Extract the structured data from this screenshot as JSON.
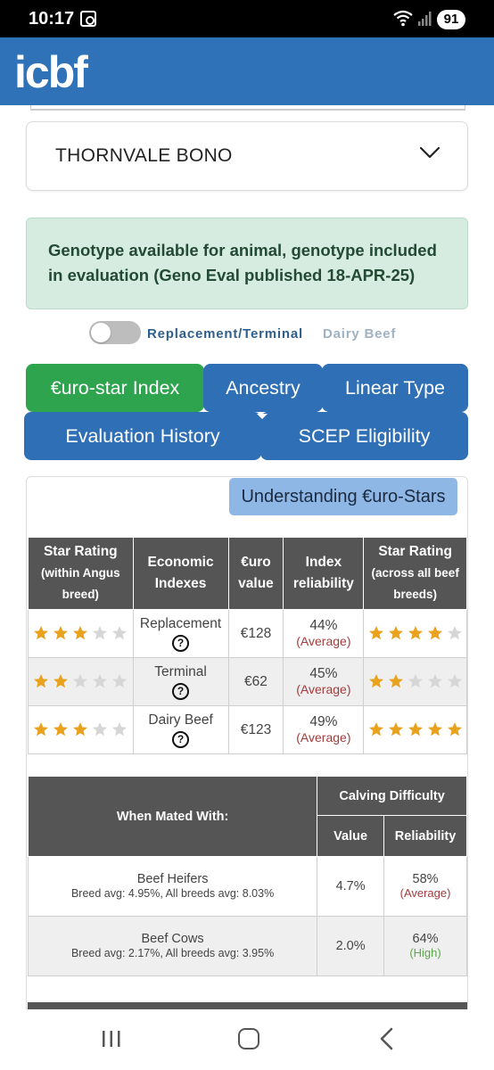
{
  "status_bar": {
    "time": "10:17",
    "battery": "91"
  },
  "header": {
    "logo_text": "icbf"
  },
  "animal": {
    "name": "THORNVALE BONO"
  },
  "alert": {
    "text": "Genotype available for animal, genotype included in evaluation (Geno Eval published 18-APR-25)"
  },
  "toggle": {
    "label_active": "Replacement/Terminal",
    "label_inactive": "Dairy Beef",
    "state": "off"
  },
  "tabs": [
    {
      "label": "€uro-star Index",
      "active": true
    },
    {
      "label": "Ancestry",
      "active": false
    },
    {
      "label": "Linear Type",
      "active": false
    },
    {
      "label": "Evaluation History",
      "active": false
    },
    {
      "label": "SCEP Eligibility",
      "active": false
    }
  ],
  "understanding_button": "Understanding €uro-Stars",
  "index_table": {
    "headers": {
      "star_within": "Star Rating",
      "star_within_sub": "(within Angus breed)",
      "economic": "Economic Indexes",
      "euro": "€uro value",
      "reliability": "Index reliability",
      "star_across": "Star Rating",
      "star_across_sub": "(across all beef breeds)"
    },
    "rows": [
      {
        "stars_within": 3,
        "index": "Replacement",
        "value": "€128",
        "reliability": "44%",
        "reliability_note": "(Average)",
        "stars_across": 4
      },
      {
        "stars_within": 2,
        "index": "Terminal",
        "value": "€62",
        "reliability": "45%",
        "reliability_note": "(Average)",
        "stars_across": 2
      },
      {
        "stars_within": 3,
        "index": "Dairy Beef",
        "value": "€123",
        "reliability": "49%",
        "reliability_note": "(Average)",
        "stars_across": 5
      }
    ],
    "help_glyph": "?"
  },
  "calving_table": {
    "header_mated": "When Mated With:",
    "header_group": "Calving Difficulty",
    "header_value": "Value",
    "header_reliability": "Reliability",
    "rows": [
      {
        "group": "Beef Heifers",
        "note": "Breed avg: 4.95%, All breeds avg: 8.03%",
        "value": "4.7%",
        "reliability": "58%",
        "reliability_note": "(Average)"
      },
      {
        "group": "Beef Cows",
        "note": "Breed avg: 2.17%, All breeds avg: 3.95%",
        "value": "2.0%",
        "reliability": "64%",
        "reliability_note": "(High)"
      }
    ]
  },
  "colors": {
    "header_blue": "#2f72b8",
    "tab_blue": "#2f6fb5",
    "tab_active_green": "#2ea44f",
    "star_filled": "#e8a21d",
    "star_empty": "#d6d6d6",
    "table_header": "#555555",
    "alert_bg": "#d7ece0"
  }
}
